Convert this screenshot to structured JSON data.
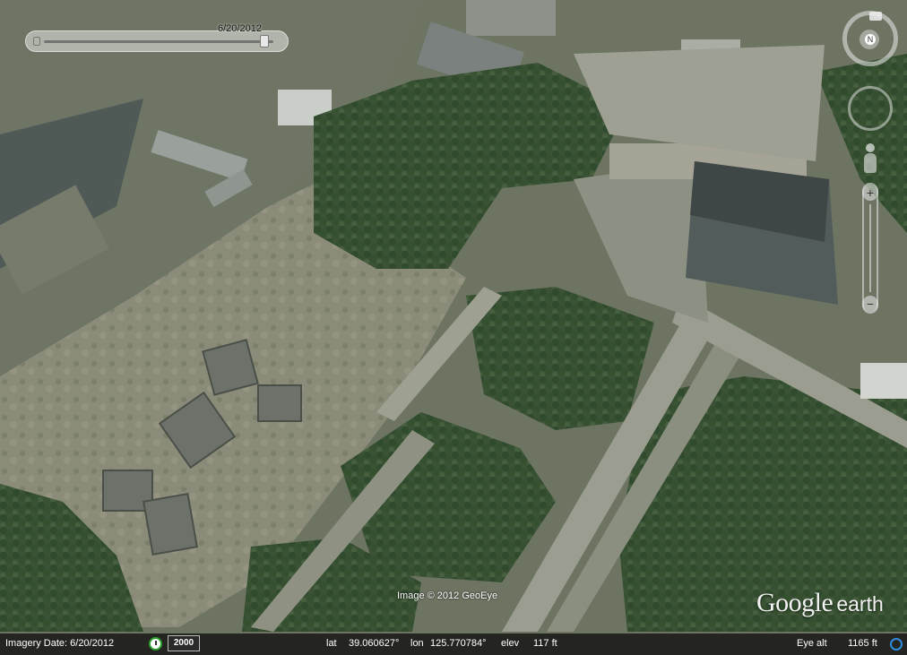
{
  "time_slider": {
    "date_label": "6/20/2012",
    "position": 0.98
  },
  "attribution": "Image © 2012 GeoEye",
  "logo": {
    "google": "Google",
    "earth": "earth"
  },
  "status_bar": {
    "imagery_date": "Imagery Date: 6/20/2012",
    "year": "2000",
    "lat_label": "lat",
    "lat_value": "39.060627°",
    "lon_label": "lon",
    "lon_value": "125.770784°",
    "elev_label": "elev",
    "elev_value": "117 ft",
    "eye_alt_label": "Eye alt",
    "eye_alt_value": "1165 ft"
  },
  "navigation": {
    "compass_label": "N",
    "zoom_in": "+",
    "zoom_out": "−"
  },
  "colors": {
    "status_bg": "#141414",
    "clock_accent": "#2ca02c",
    "stream_accent": "#2e8bdb"
  },
  "icons": [
    "compass-icon",
    "look-joystick-icon",
    "pegman-icon",
    "zoom-slider-icon",
    "clock-icon",
    "streaming-icon"
  ]
}
